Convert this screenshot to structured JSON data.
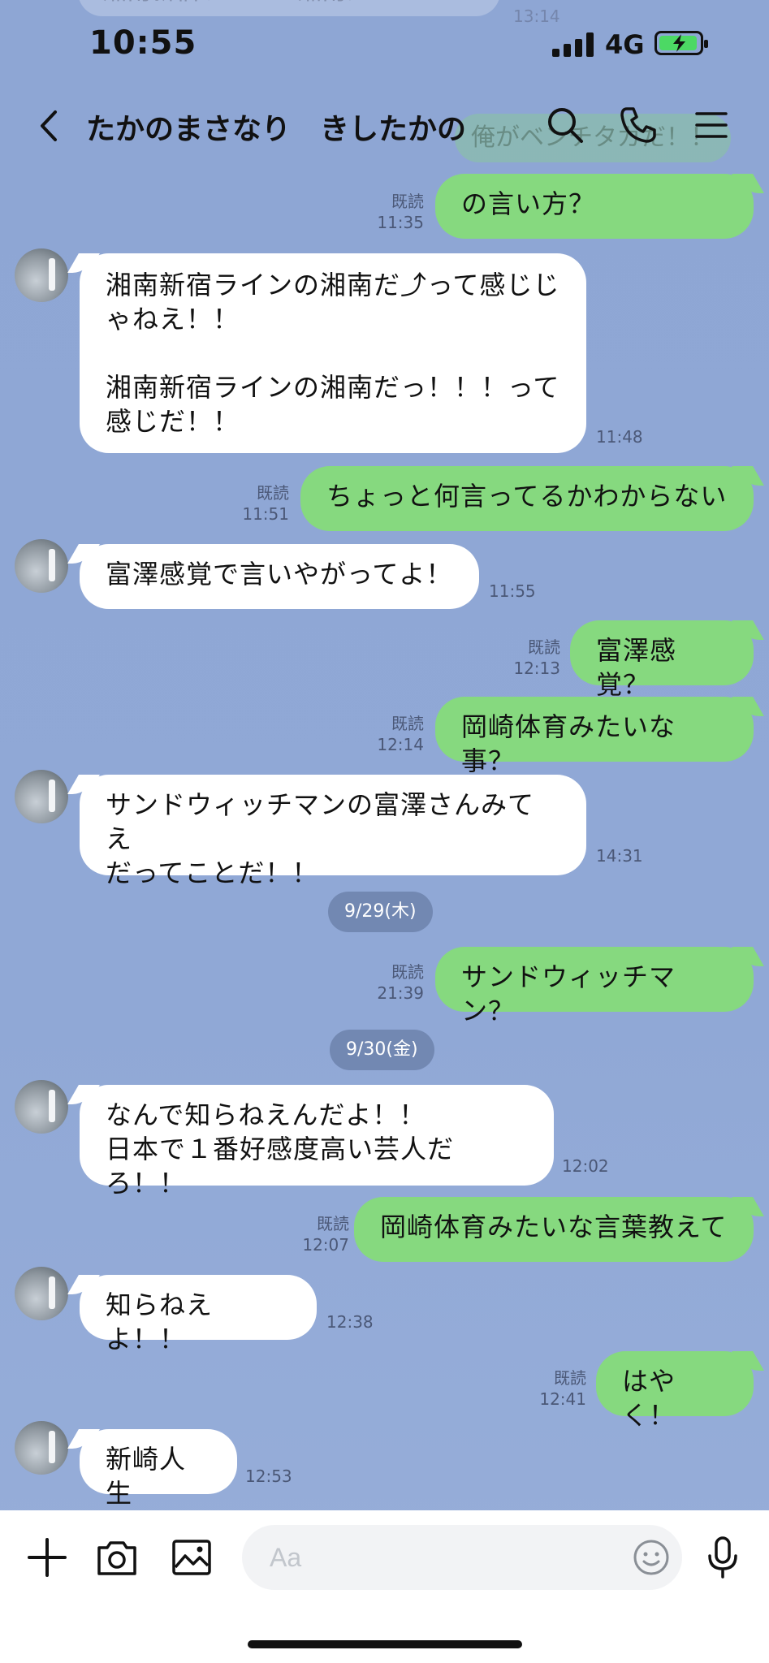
{
  "status_bar": {
    "time": "10:55",
    "network": "4G"
  },
  "header": {
    "title": "たかのまさなり　きしたかの",
    "icons": [
      "back-icon",
      "search-icon",
      "phone-icon",
      "menu-icon"
    ]
  },
  "background_residue": {
    "top_bubble": "湘南新宿ラインの湘南だ！！！",
    "top_time": "13:14",
    "header_bubble": "俺がベンチタガだ！！"
  },
  "messages": [
    {
      "dir": "out",
      "text": "の言い方？",
      "read": "既読",
      "time": "11:35"
    },
    {
      "dir": "in",
      "text": "湘南新宿ラインの湘南だ⤴って感じじ\nゃねえ！！\n\n湘南新宿ラインの湘南だっ！！！って\n感じだ！！",
      "time": "11:48"
    },
    {
      "dir": "out",
      "text": "ちょっと何言ってるかわからない",
      "read": "既読",
      "time": "11:51"
    },
    {
      "dir": "in",
      "text": "富澤感覚で言いやがってよ！",
      "time": "11:55"
    },
    {
      "dir": "out",
      "text": "富澤感覚？",
      "read": "既読",
      "time": "12:13"
    },
    {
      "dir": "out",
      "text": "岡崎体育みたいな事？",
      "read": "既読",
      "time": "12:14"
    },
    {
      "dir": "in",
      "text": "サンドウィッチマンの富澤さんみてえ\nだってことだ！！",
      "time": "14:31"
    },
    {
      "dir": "date",
      "text": "9/29(木)"
    },
    {
      "dir": "out",
      "text": "サンドウィッチマン？",
      "read": "既読",
      "time": "21:39"
    },
    {
      "dir": "date",
      "text": "9/30(金)"
    },
    {
      "dir": "in",
      "text": "なんで知らねえんだよ！！\n日本で１番好感度高い芸人だろ！！",
      "time": "12:02"
    },
    {
      "dir": "out",
      "text": "岡崎体育みたいな言葉教えて",
      "read": "既読",
      "time": "12:07"
    },
    {
      "dir": "in",
      "text": "知らねえよ！！",
      "time": "12:38"
    },
    {
      "dir": "out",
      "text": "はやく！",
      "read": "既読",
      "time": "12:41"
    },
    {
      "dir": "in",
      "text": "新崎人生",
      "time": "12:53"
    }
  ],
  "composer": {
    "placeholder": "Aa",
    "icons": [
      "plus-icon",
      "camera-icon",
      "image-icon",
      "emoji-icon",
      "mic-icon"
    ]
  },
  "colors": {
    "background": "#90a8d6",
    "incoming_bubble": "#ffffff",
    "outgoing_bubble": "#86d97f",
    "meta_text": "#4b5877"
  }
}
